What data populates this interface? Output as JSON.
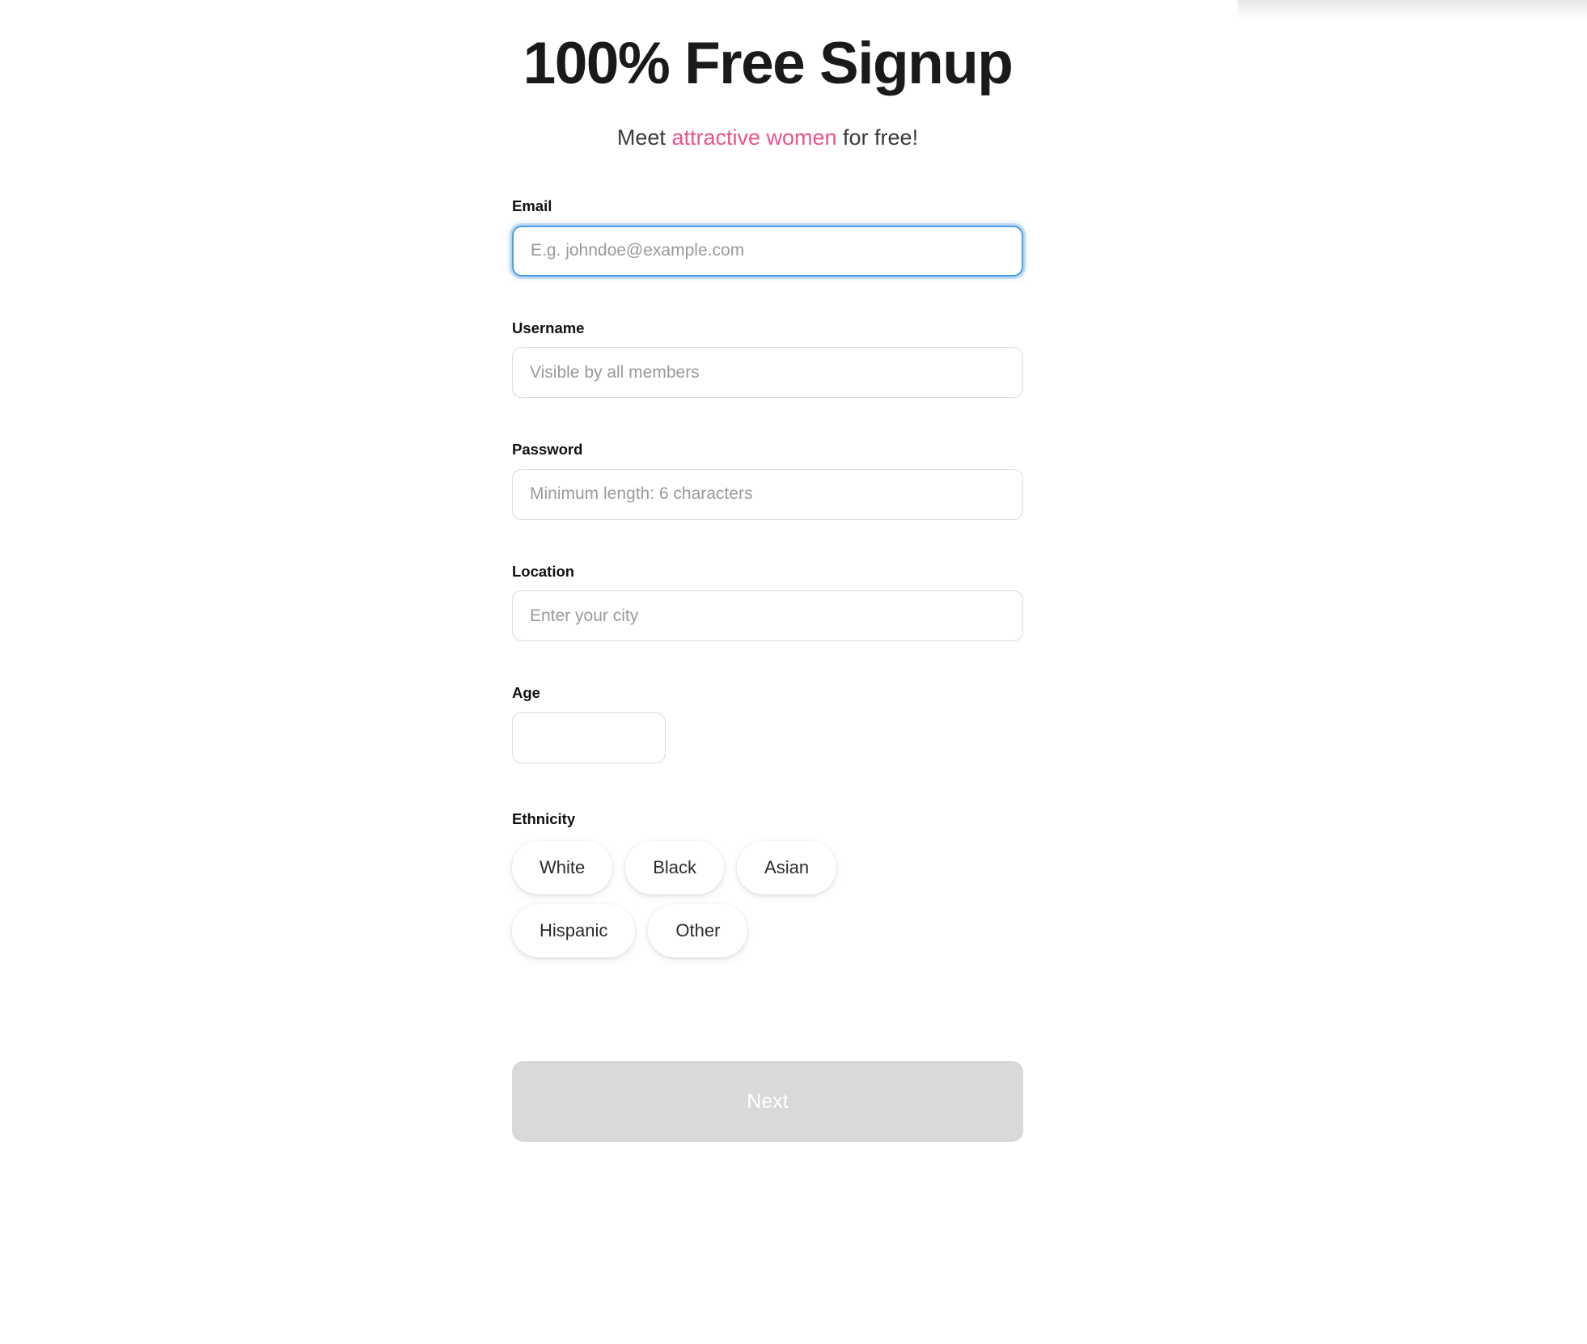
{
  "header": {
    "title": "100% Free Signup",
    "subtitle_prefix": "Meet ",
    "subtitle_accent": "attractive women",
    "subtitle_suffix": " for free!",
    "accent_color": "#e9548c"
  },
  "form": {
    "email": {
      "label": "Email",
      "placeholder": "E.g. johndoe@example.com",
      "value": "",
      "focused": true,
      "focus_color": "#4a9fe8"
    },
    "username": {
      "label": "Username",
      "placeholder": "Visible by all members",
      "value": ""
    },
    "password": {
      "label": "Password",
      "placeholder": "Minimum length: 6 characters",
      "value": ""
    },
    "location": {
      "label": "Location",
      "placeholder": "Enter your city",
      "value": ""
    },
    "age": {
      "label": "Age",
      "placeholder": "",
      "value": ""
    },
    "ethnicity": {
      "label": "Ethnicity",
      "selected": "",
      "options_row1": [
        "White",
        "Black",
        "Asian"
      ],
      "options_row2": [
        "Hispanic",
        "Other"
      ]
    }
  },
  "actions": {
    "next_label": "Next",
    "next_disabled": true,
    "next_bg_color": "#d9d9d9"
  }
}
